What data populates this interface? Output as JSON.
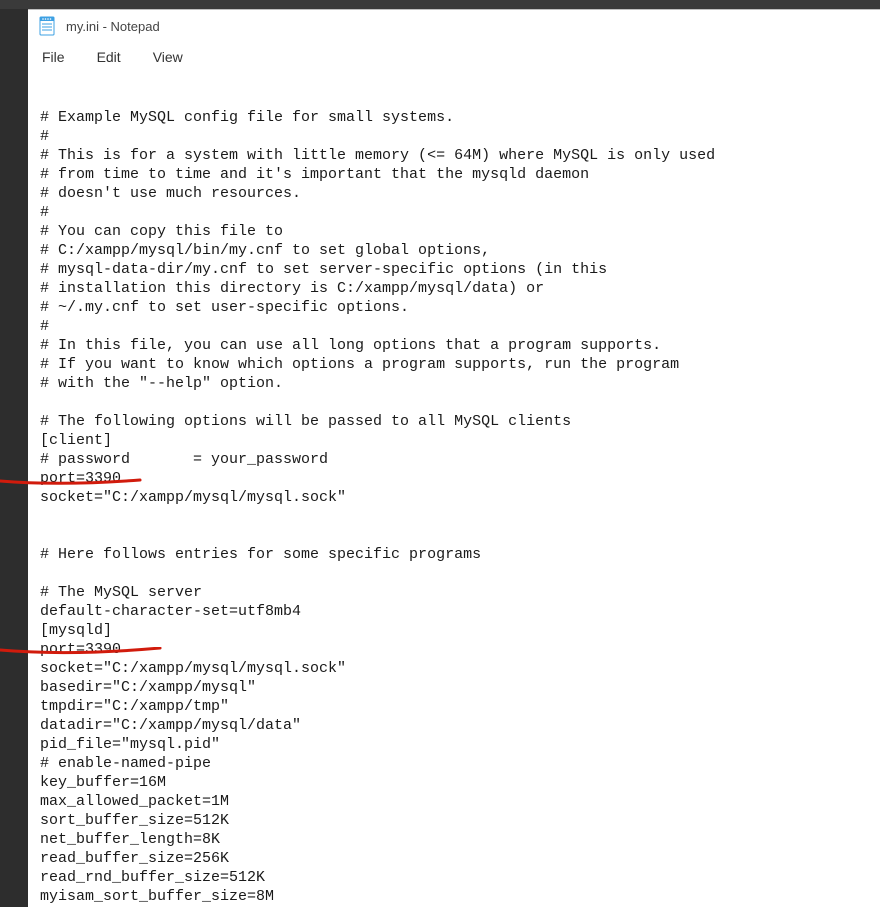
{
  "window": {
    "title": "my.ini - Notepad"
  },
  "menu": {
    "file": "File",
    "edit": "Edit",
    "view": "View"
  },
  "content": "# Example MySQL config file for small systems.\n#\n# This is for a system with little memory (<= 64M) where MySQL is only used\n# from time to time and it's important that the mysqld daemon\n# doesn't use much resources.\n#\n# You can copy this file to\n# C:/xampp/mysql/bin/my.cnf to set global options,\n# mysql-data-dir/my.cnf to set server-specific options (in this\n# installation this directory is C:/xampp/mysql/data) or\n# ~/.my.cnf to set user-specific options.\n#\n# In this file, you can use all long options that a program supports.\n# If you want to know which options a program supports, run the program\n# with the \"--help\" option.\n\n# The following options will be passed to all MySQL clients\n[client]\n# password       = your_password\nport=3390\nsocket=\"C:/xampp/mysql/mysql.sock\"\n\n\n# Here follows entries for some specific programs\n\n# The MySQL server\ndefault-character-set=utf8mb4\n[mysqld]\nport=3390\nsocket=\"C:/xampp/mysql/mysql.sock\"\nbasedir=\"C:/xampp/mysql\"\ntmpdir=\"C:/xampp/tmp\"\ndatadir=\"C:/xampp/mysql/data\"\npid_file=\"mysql.pid\"\n# enable-named-pipe\nkey_buffer=16M\nmax_allowed_packet=1M\nsort_buffer_size=512K\nnet_buffer_length=8K\nread_buffer_size=256K\nread_rnd_buffer_size=512K\nmyisam_sort_buffer_size=8M"
}
